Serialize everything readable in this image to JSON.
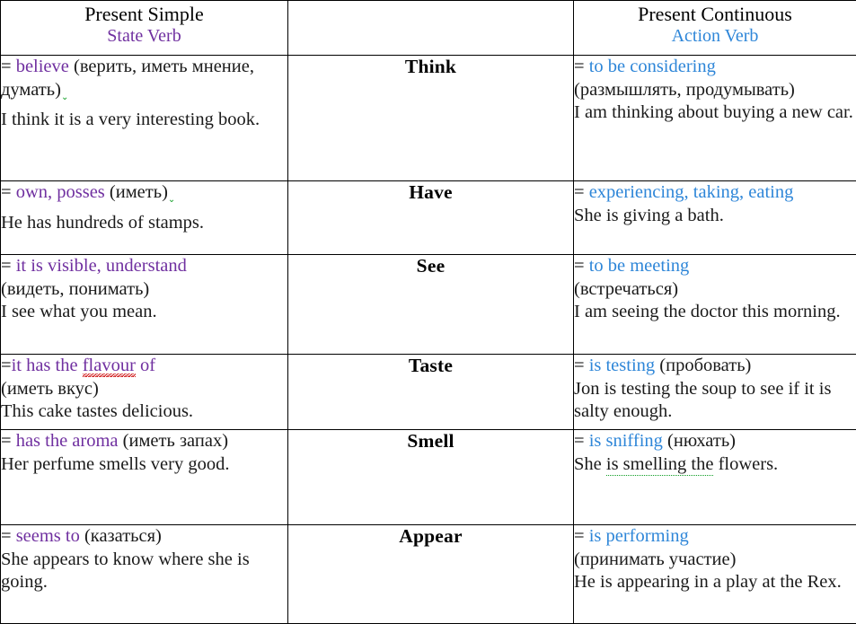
{
  "table": {
    "headers": {
      "state": {
        "main": "Present Simple",
        "sub": "State Verb",
        "color": "#7030a0"
      },
      "verb": {
        "main": "",
        "sub": ""
      },
      "action": {
        "main": "Present Continuous",
        "sub": "Action Verb",
        "color": "#2e86d8"
      }
    },
    "rows": [
      {
        "verb": "Think",
        "state": {
          "equals": "=",
          "definition": "believe",
          "russian": "(верить, иметь мнение, думать)",
          "example": "I think it is a very interesting book."
        },
        "action": {
          "equals": "=",
          "definition": "to be considering",
          "russian": "(размышлять, продумывать)",
          "example": "I am thinking about buying a new car."
        }
      },
      {
        "verb": "Have",
        "state": {
          "equals": "=",
          "definition": "own, posses",
          "russian": "(иметь)",
          "example": "He has hundreds of stamps."
        },
        "action": {
          "equals": "=",
          "definition": "experiencing, taking, eating",
          "russian": "",
          "example": "She is giving a bath."
        }
      },
      {
        "verb": "See",
        "state": {
          "equals": "=",
          "definition": "it is visible, understand",
          "russian": "(видеть, понимать)",
          "example": "I see what you mean."
        },
        "action": {
          "equals": "=",
          "definition": "to be meeting",
          "russian": "(встречаться)",
          "example": "I am seeing the doctor this morning."
        }
      },
      {
        "verb": "Taste",
        "state": {
          "equals": "=",
          "definition_pre": "it has the ",
          "definition_flagged": "flavour",
          "definition_post": " of",
          "definition": "it has the flavour of",
          "russian": "(иметь вкус)",
          "example": "This cake tastes delicious."
        },
        "action": {
          "equals": "=",
          "definition": "is testing",
          "russian": "(пробовать)",
          "example": "Jon is testing the soup to see if it is salty enough."
        }
      },
      {
        "verb": "Smell",
        "state": {
          "equals": "=",
          "definition": "has the aroma",
          "russian": "(иметь запах)",
          "example": "Her perfume smells very good."
        },
        "action": {
          "equals": "=",
          "definition": "is sniffing",
          "russian": "(нюхать)",
          "example_pre": "She ",
          "example_flagged": "is smelling the",
          "example_post": " flowers.",
          "example": "She is smelling the flowers."
        }
      },
      {
        "verb": "Appear",
        "state": {
          "equals": "=",
          "definition": "seems to",
          "russian": "(казаться)",
          "example": "She appears to know where she is going."
        },
        "action": {
          "equals": "=",
          "definition": "is performing",
          "russian": "(принимать участие)",
          "example": "He is appearing in a play at the Rex."
        }
      }
    ]
  }
}
